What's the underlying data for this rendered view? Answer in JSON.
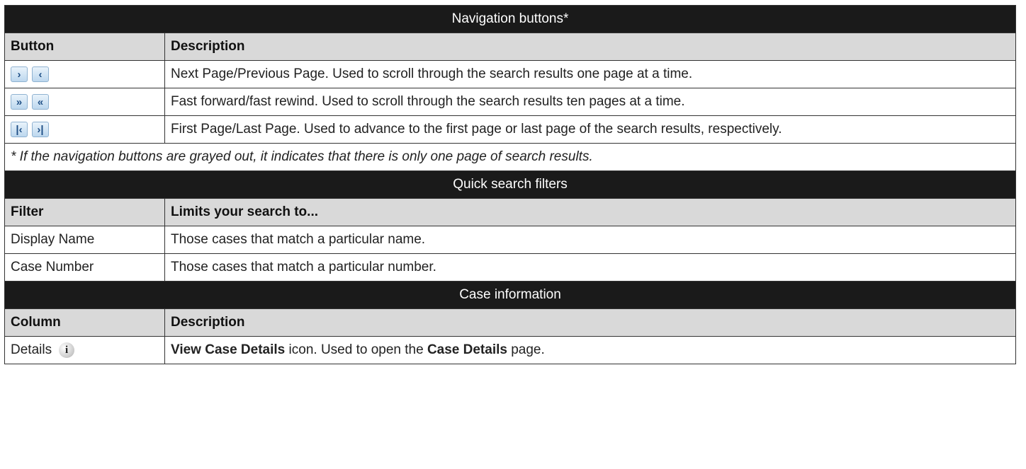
{
  "nav": {
    "title": "Navigation buttons*",
    "col_button": "Button",
    "col_description": "Description",
    "rows": [
      {
        "buttons": [
          "›",
          "‹"
        ],
        "button_icons": [
          "next-page-icon",
          "previous-page-icon"
        ],
        "description": "Next Page/Previous Page. Used to scroll through the search results one page at a time."
      },
      {
        "buttons": [
          "»",
          "«"
        ],
        "button_icons": [
          "fast-forward-icon",
          "fast-rewind-icon"
        ],
        "description": "Fast forward/fast rewind. Used to scroll through the search results ten pages at a time."
      },
      {
        "buttons": [
          "|‹",
          "›|"
        ],
        "button_icons": [
          "first-page-icon",
          "last-page-icon"
        ],
        "description": "First Page/Last Page. Used to advance to the first page or last page of the search results, respectively."
      }
    ],
    "note": "* If the navigation buttons are grayed out, it indicates that there is only one page of search results."
  },
  "filters": {
    "title": "Quick search filters",
    "col_filter": "Filter",
    "col_limits": "Limits your search to...",
    "rows": [
      {
        "filter": "Display Name",
        "description": "Those cases that match a particular name."
      },
      {
        "filter": "Case Number",
        "description": "Those cases that match a particular number."
      }
    ]
  },
  "case_info": {
    "title": "Case information",
    "col_column": "Column",
    "col_description": "Description",
    "rows": [
      {
        "column": "Details",
        "icon": "info-icon",
        "icon_glyph": "i",
        "desc_bold1": "View Case Details",
        "desc_text1": " icon. Used to open the ",
        "desc_bold2": "Case Details",
        "desc_text2": " page."
      }
    ]
  },
  "colors": {
    "header_bg": "#1a1a1a",
    "subheader_bg": "#d9d9d9",
    "button_blue": "#bcd7ee"
  }
}
